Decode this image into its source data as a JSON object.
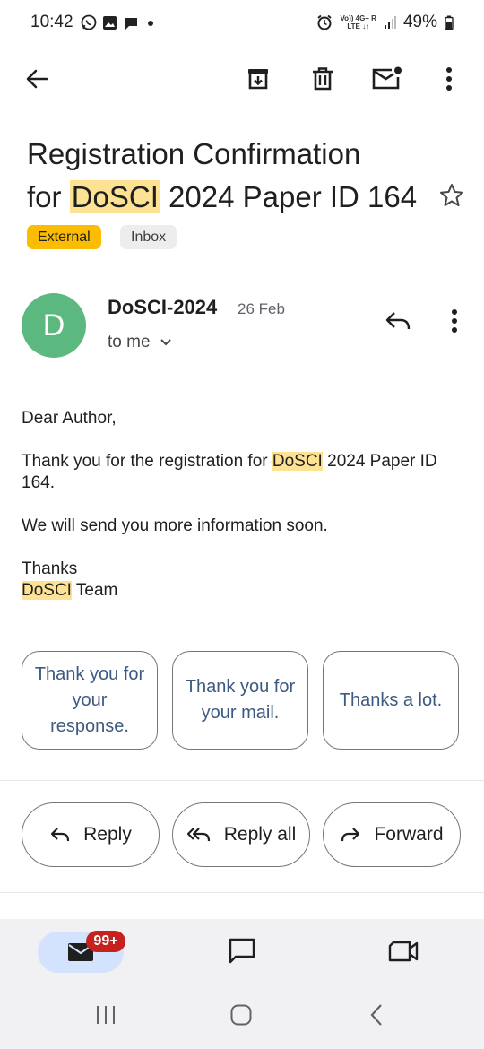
{
  "status_bar": {
    "time": "10:42",
    "battery": "49%",
    "network_line1": "Vo)) 4G+ R",
    "network_line2": "LTE ↓↑"
  },
  "toolbar": {
    "back_icon": "arrow-left-icon",
    "archive_icon": "archive-icon",
    "delete_icon": "trash-icon",
    "mark_unread_icon": "mail-unread-icon",
    "more_icon": "more-vert-icon"
  },
  "subject": {
    "line1": "Registration Confirmation",
    "line2_before": "for ",
    "line2_highlight": "DoSCI",
    "line2_after": " 2024 Paper ID 164",
    "star_icon": "star-outline-icon"
  },
  "labels": [
    "External",
    "Inbox"
  ],
  "message": {
    "avatar_letter": "D",
    "sender": "DoSCI-2024",
    "date": "26 Feb",
    "recipient": "to me",
    "greeting": "Dear Author,",
    "para1_before": "Thank you for the registration for ",
    "para1_highlight": "DoSCI",
    "para1_after": " 2024 Paper ID 164.",
    "para2": "We will send you more information soon.",
    "closing": "Thanks",
    "signature_highlight": "DoSCI",
    "signature_after": " Team"
  },
  "smart_replies": [
    "Thank you for your response.",
    "Thank you for your mail.",
    "Thanks a lot."
  ],
  "actions": {
    "reply": "Reply",
    "reply_all": "Reply all",
    "forward": "Forward"
  },
  "bottom_nav": {
    "mail_badge": "99+"
  },
  "colors": {
    "highlight": "#fde293",
    "external_chip": "#fbbc04",
    "avatar": "#5bb97f",
    "badge": "#c5221f",
    "mail_pill": "#d3e3fd"
  }
}
